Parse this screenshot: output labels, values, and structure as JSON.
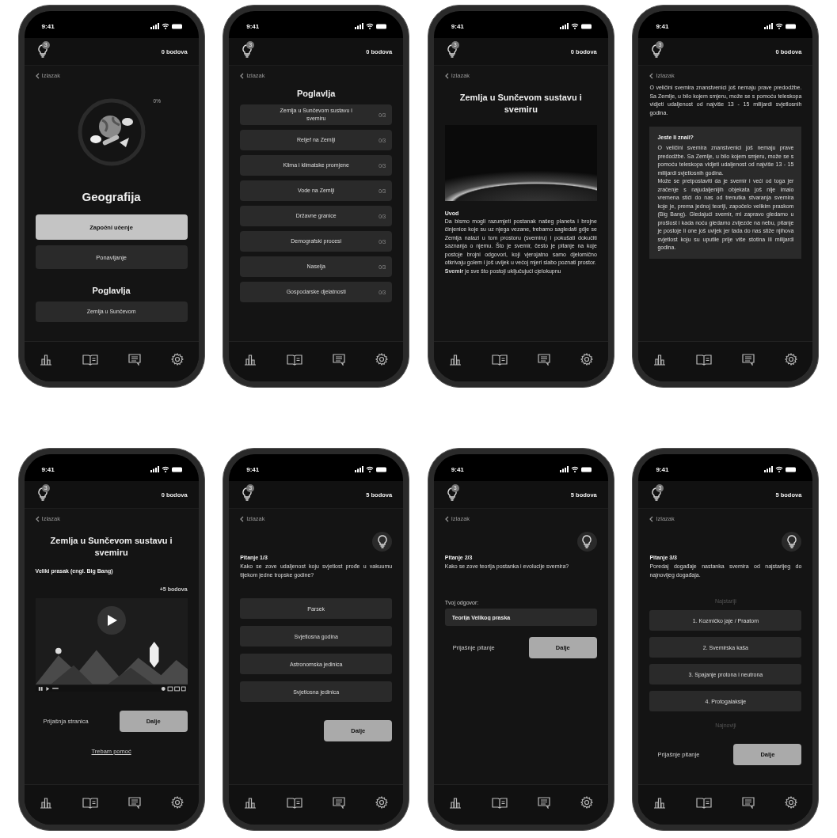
{
  "screens": [
    {
      "time": "9:41",
      "hints": "3",
      "points": "0 bodova",
      "back": "Izlazak",
      "blocks": [
        {
          "kind": "progress",
          "label": "0%",
          "level": 0
        },
        {
          "kind": "title",
          "text": "Geografija"
        },
        {
          "kind": "button",
          "label": "Započni učenje",
          "primary": true
        },
        {
          "kind": "button",
          "label": "Ponavljanje",
          "primary": false
        },
        {
          "kind": "section",
          "text": "Poglavlja"
        },
        {
          "kind": "chapter",
          "title": "Zemlja u Sunčevom"
        }
      ]
    },
    {
      "time": "9:41",
      "hints": "3",
      "points": "0 bodova",
      "back": "Izlazak",
      "blocks": [
        {
          "kind": "section",
          "text": "Poglavlja"
        },
        {
          "kind": "chapter",
          "title": "Zemlja u Sunčevom sustavu i svemiru",
          "count": "0/3"
        },
        {
          "kind": "chapter",
          "title": "Reljef na Zemlji",
          "count": "0/3"
        },
        {
          "kind": "chapter",
          "title": "Klima i klimatske promjene",
          "count": "0/3"
        },
        {
          "kind": "chapter",
          "title": "Vode na Zemlji",
          "count": "0/3"
        },
        {
          "kind": "chapter",
          "title": "Državne granice",
          "count": "0/3"
        },
        {
          "kind": "chapter",
          "title": "Demografski procesi",
          "count": "0/3"
        },
        {
          "kind": "chapter",
          "title": "Naselja",
          "count": "0/3"
        },
        {
          "kind": "chapter",
          "title": "Gospodarske djelatnosti",
          "count": "0/3"
        }
      ]
    },
    {
      "time": "9:41",
      "hints": "3",
      "points": "0 bodova",
      "back": "Izlazak",
      "blocks": [
        {
          "kind": "heading",
          "text": "Zemlja u Sunčevom sustavu i svemiru"
        },
        {
          "kind": "photo"
        },
        {
          "kind": "label",
          "text": "Uvod"
        },
        {
          "kind": "paragraph",
          "text": "Da bismo mogli razumjeti postanak našeg planeta i brojne činjenice koje su uz njega vezane, trebamo sagledati gdje se Zemlja nalazi u tom prostoru (svemiru) i pokušati dokučiti saznanja o njemu. Što je svemir, često je pitanje na koje postoje brojni odgovori, koji vjerojatno samo djelomično otkrivaju golem i još uvijek u većoj mjeri slabo poznati prostor."
        },
        {
          "kind": "paragraph",
          "text": "**Svemir** je sve što postoji uključujući cjelokupnu"
        }
      ]
    },
    {
      "time": "9:41",
      "hints": "3",
      "points": "0 bodova",
      "back": "Izlazak",
      "blocks": [
        {
          "kind": "paragraph",
          "text": "O veličini svemira znanstvenici još nemaju prave predodžbe. Sa Zemlje, u bilo kojem smjeru, može se s pomoću teleskopa vidjeti udaljenost od najviše 13 - 15 milijardi svjetlosnih godina."
        },
        {
          "kind": "callout",
          "title": "Jeste li znali?",
          "paragraphs": [
            "O veličini svemira znanstvenici još nemaju prave predodžbe. Sa Zemlje, u bilo kojem smjeru, može se s pomoću teleskopa vidjeti udaljenost od najviše 13 - 15 milijardi svjetlosnih godina.",
            "Može se pretpostaviti da je svemir i veći od toga jer zračenje s najudaljenijih objekata još nije imalo vremena stići do nas od trenutka stvaranja svemira koje je, prema jednoj teoriji, započelo velikim praskom (Big Bang). Gledajući svemir, mi zapravo gledamo u prošlost i kada noću gledamo zvijezde na nebu, pitanje je postoje li one još uvijek jer tada do nas stiže njihova svjetlost koju su uputile prije više stotina ili milijardi godina."
          ]
        }
      ]
    },
    {
      "time": "9:41",
      "hints": "3",
      "points": "0 bodova",
      "back": "Izlazak",
      "blocks": [
        {
          "kind": "heading",
          "text": "Zemlja u Sunčevom sustavu i svemiru"
        },
        {
          "kind": "label",
          "text": "Veliki prasak (engl. Big Bang)"
        },
        {
          "kind": "reward",
          "text": "+5 bodova"
        },
        {
          "kind": "video"
        },
        {
          "kind": "nav",
          "back_label": "Prijašnja stranica",
          "next_label": "Dalje"
        },
        {
          "kind": "link",
          "text": "Trebam pomoć"
        }
      ]
    },
    {
      "time": "9:41",
      "hints": "3",
      "points": "5 bodova",
      "back": "Izlazak",
      "blocks": [
        {
          "kind": "hint"
        },
        {
          "kind": "question",
          "label": "Pitanje 1/3",
          "text": "Kako se zove udaljenost koju svjetlost prođe u vakuumu tijekom jedne tropske godine?"
        },
        {
          "kind": "option",
          "label": "Parsek"
        },
        {
          "kind": "option",
          "label": "Svjetlosna godina"
        },
        {
          "kind": "option",
          "label": "Astronomska jedinica"
        },
        {
          "kind": "option",
          "label": "Svjetlosna jedinica"
        },
        {
          "kind": "next",
          "label": "Dalje"
        }
      ]
    },
    {
      "time": "9:41",
      "hints": "3",
      "points": "5 bodova",
      "back": "Izlazak",
      "blocks": [
        {
          "kind": "hint"
        },
        {
          "kind": "question",
          "label": "Pitanje 2/3",
          "text": "Kako se zove teorija postanka i evolucije svemira?"
        },
        {
          "kind": "answer",
          "label": "Tvoj odgovor:",
          "value": "Teorija Velikog praska"
        },
        {
          "kind": "nav",
          "back_label": "Prijašnje pitanje",
          "next_label": "Dalje"
        }
      ]
    },
    {
      "time": "9:41",
      "hints": "3",
      "points": "5 bodova",
      "back": "Izlazak",
      "blocks": [
        {
          "kind": "hint"
        },
        {
          "kind": "question",
          "label": "Pitanje 3/3",
          "text": "Poredaj događaje nastanka svemira od najstarijeg do najnovijeg događaja."
        },
        {
          "kind": "end_label",
          "text": "Najstariji"
        },
        {
          "kind": "order_item",
          "label": "1. Kozmičko jaje / Praatom"
        },
        {
          "kind": "order_item",
          "label": "2. Svemirska kaša"
        },
        {
          "kind": "order_item",
          "label": "3. Spajanje protona i neutrona"
        },
        {
          "kind": "order_item",
          "label": "4. Protogalaksije"
        },
        {
          "kind": "end_label",
          "text": "Najnoviji"
        },
        {
          "kind": "nav",
          "back_label": "Prijašnje pitanje",
          "next_label": "Dalje"
        }
      ]
    }
  ]
}
